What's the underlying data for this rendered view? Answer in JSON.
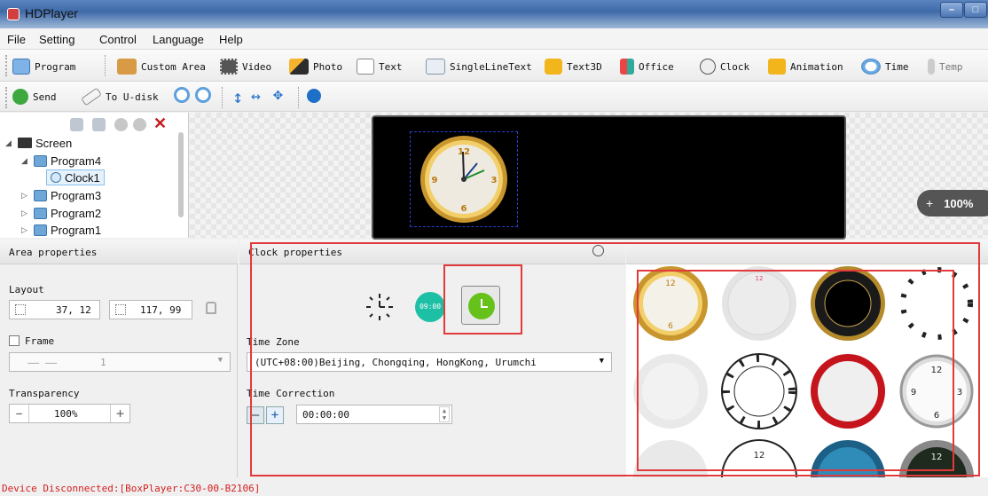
{
  "window": {
    "title": "HDPlayer"
  },
  "menu": [
    "File",
    "Setting",
    "Control",
    "Language",
    "Help"
  ],
  "toolbar1": [
    {
      "icon": "program-icon",
      "label": "Program"
    },
    {
      "icon": "custom-area-icon",
      "label": "Custom Area"
    },
    {
      "icon": "video-icon",
      "label": "Video"
    },
    {
      "icon": "photo-icon",
      "label": "Photo"
    },
    {
      "icon": "text-icon",
      "label": "Text"
    },
    {
      "icon": "single-line-text-icon",
      "label": "SingleLineText"
    },
    {
      "icon": "text3d-icon",
      "label": "Text3D"
    },
    {
      "icon": "office-icon",
      "label": "Office"
    },
    {
      "icon": "clock-icon",
      "label": "Clock"
    },
    {
      "icon": "animation-icon",
      "label": "Animation"
    },
    {
      "icon": "time-icon",
      "label": "Time"
    },
    {
      "icon": "temp-icon",
      "label": "Temp"
    }
  ],
  "toolbar2": {
    "send": "Send",
    "to_udisk": "To U-disk"
  },
  "tree": {
    "screen": "Screen",
    "program4": "Program4",
    "clock1": "Clock1",
    "program3": "Program3",
    "program2": "Program2",
    "program1": "Program1"
  },
  "zoom": {
    "plus": "+",
    "value": "100%"
  },
  "area": {
    "header": "Area properties",
    "layout_label": "Layout",
    "x": "37, 12",
    "size": "117, 99",
    "frame_label": "Frame",
    "frame_value": "1",
    "transparency_label": "Transparency",
    "transparency_value": "100%",
    "minus": "—",
    "plus": "+"
  },
  "clock": {
    "header": "Clock properties",
    "digital_time": "09:00",
    "timezone_label": "Time Zone",
    "timezone_value": "(UTC+08:00)Beijing, Chongqing, HongKong, Urumchi",
    "correction_label": "Time Correction",
    "correction_value": "00:00:00",
    "minus": "—",
    "plus": "+"
  },
  "status": "Device Disconnected:[BoxPlayer:C30-00-B2106]",
  "colors": {
    "titlebar": "#3e6aa8",
    "highlight_border": "#e23a3a",
    "status_text": "#d42020",
    "accent_green": "#66c21a"
  }
}
